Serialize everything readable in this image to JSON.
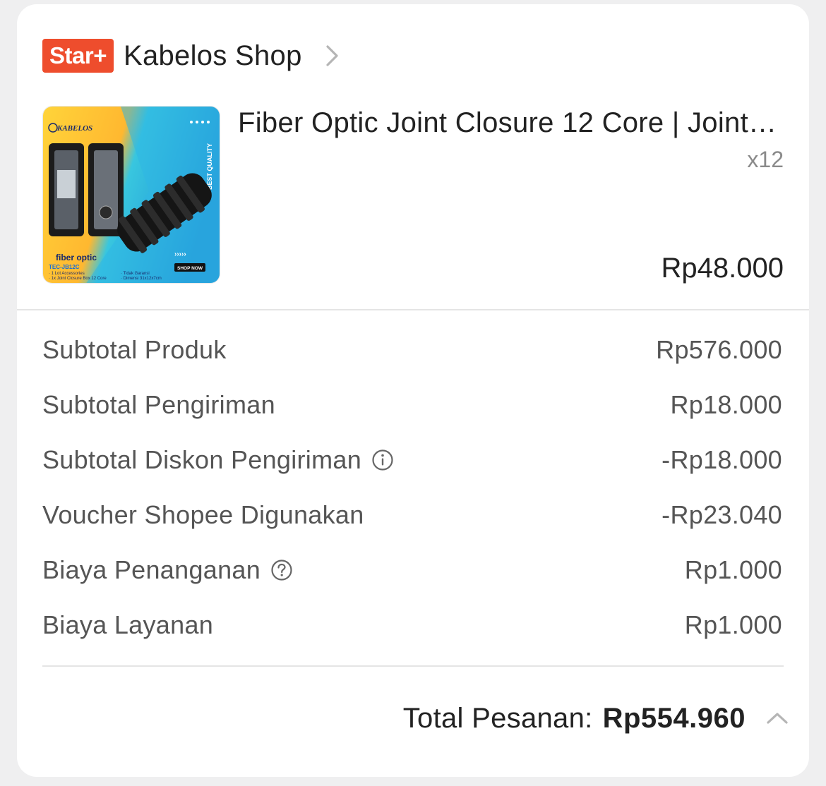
{
  "shop": {
    "badge": "Star+",
    "name": "Kabelos Shop"
  },
  "product": {
    "title": "Fiber Optic Joint Closure 12 Core | Joint Box Closure",
    "quantity": "x12",
    "price": "Rp48.000",
    "image": {
      "brand": "KABELOS",
      "tag": "BEST QUALITY",
      "category": "fiber optic",
      "model": "TEC-JB12C",
      "cta": "SHOP NOW",
      "arrows": "›››››",
      "notes_left": [
        "· 1 Lot Accessories",
        "· 1x Joint Closure Box 12 Core"
      ],
      "notes_right": [
        "· Tidak Garansi",
        "· Dimensi 31x12x7cm"
      ]
    }
  },
  "summary": {
    "rows": [
      {
        "label": "Subtotal Produk",
        "value": "Rp576.000"
      },
      {
        "label": "Subtotal Pengiriman",
        "value": "Rp18.000"
      },
      {
        "label": "Subtotal Diskon Pengiriman",
        "value": "-Rp18.000",
        "icon": "info-icon"
      },
      {
        "label": "Voucher Shopee Digunakan",
        "value": "-Rp23.040"
      },
      {
        "label": "Biaya Penanganan",
        "value": "Rp1.000",
        "icon": "help-icon"
      },
      {
        "label": "Biaya Layanan",
        "value": "Rp1.000"
      }
    ]
  },
  "total": {
    "label": "Total Pesanan:",
    "value": "Rp554.960"
  },
  "colors": {
    "brand": "#ee4d2d",
    "background": "#efeff0",
    "card": "#ffffff",
    "text_primary": "#222222",
    "text_secondary": "#555555",
    "muted": "#8a8a8a"
  }
}
